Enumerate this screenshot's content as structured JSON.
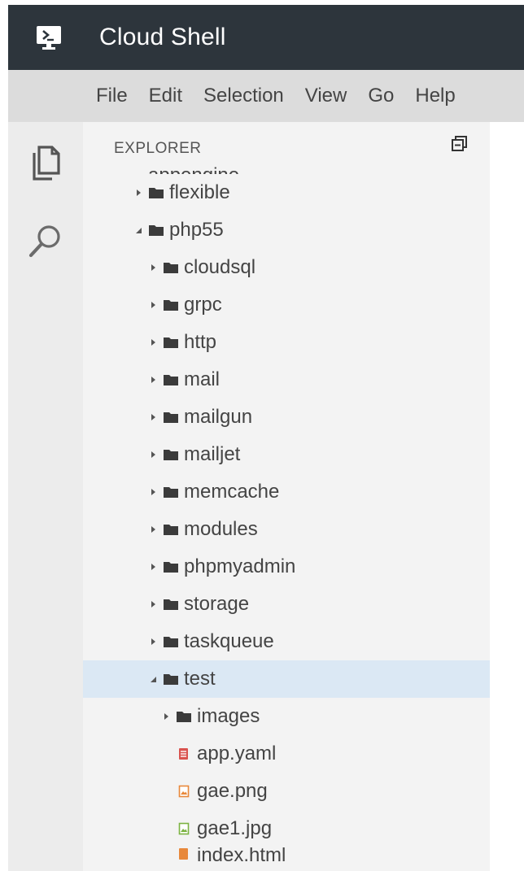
{
  "window": {
    "title": "Cloud Shell",
    "logo_icon": "cloud-shell-terminal-icon"
  },
  "menu": [
    "File",
    "Edit",
    "Selection",
    "View",
    "Go",
    "Help"
  ],
  "activity_bar": {
    "items": [
      {
        "icon": "files-icon"
      },
      {
        "icon": "search-icon"
      }
    ]
  },
  "explorer": {
    "header": "EXPLORER",
    "collapse_icon": "collapse-all-icon",
    "tree": {
      "cut_top": "appengine",
      "flexible": "flexible",
      "php55": "php55",
      "cloudsql": "cloudsql",
      "grpc": "grpc",
      "http": "http",
      "mail": "mail",
      "mailgun": "mailgun",
      "mailjet": "mailjet",
      "memcache": "memcache",
      "modules": "modules",
      "phpmyadmin": "phpmyadmin",
      "storage": "storage",
      "taskqueue": "taskqueue",
      "test": "test",
      "images": "images",
      "app_yaml": "app.yaml",
      "gae_png": "gae.png",
      "gae1_jpg": "gae1.jpg",
      "cut_bottom": "index.html"
    },
    "selected": "test"
  },
  "colors": {
    "titlebar": "#2d353c",
    "menubar": "#dcdcdc",
    "activitybar": "#ececec",
    "sidebar": "#f3f3f3",
    "selected_row": "#dbe8f4",
    "yaml_icon": "#d9534f",
    "png_icon": "#e8883a",
    "jpg_icon": "#7cb342"
  }
}
